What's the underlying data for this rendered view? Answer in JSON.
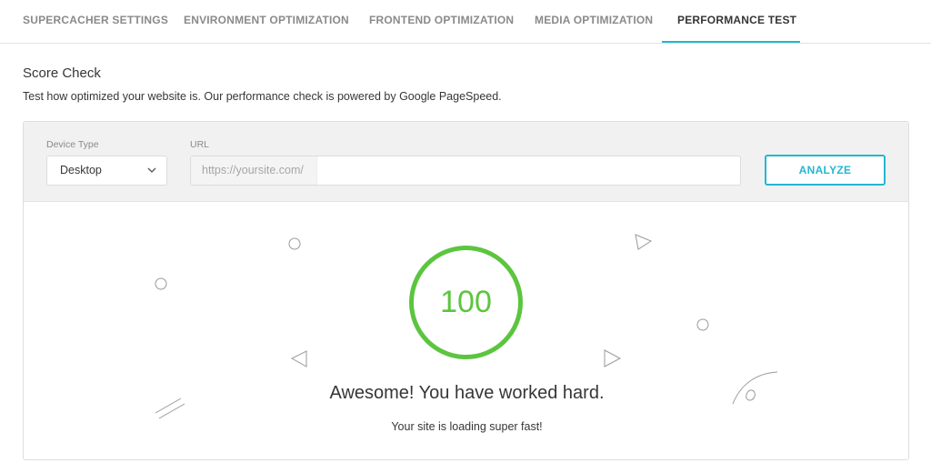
{
  "tabs": [
    {
      "label": "SUPERCACHER SETTINGS",
      "active": false
    },
    {
      "label": "ENVIRONMENT OPTIMIZATION",
      "active": false
    },
    {
      "label": "FRONTEND OPTIMIZATION",
      "active": false
    },
    {
      "label": "MEDIA OPTIMIZATION",
      "active": false
    },
    {
      "label": "PERFORMANCE TEST",
      "active": true
    }
  ],
  "section": {
    "title": "Score Check",
    "description": "Test how optimized your website is. Our performance check is powered by Google PageSpeed."
  },
  "form": {
    "device_label": "Device Type",
    "device_value": "Desktop",
    "url_label": "URL",
    "url_prefix": "https://yoursite.com/",
    "url_value": "",
    "analyze_label": "ANALYZE"
  },
  "result": {
    "score": "100",
    "score_fraction": 1.0,
    "title": "Awesome! You have worked hard.",
    "subtitle": "Your site is loading super fast!"
  },
  "colors": {
    "accent": "#22b8d1",
    "score_good": "#5cc53f"
  },
  "icons": {
    "select_chevron": "chevron-down-icon"
  }
}
